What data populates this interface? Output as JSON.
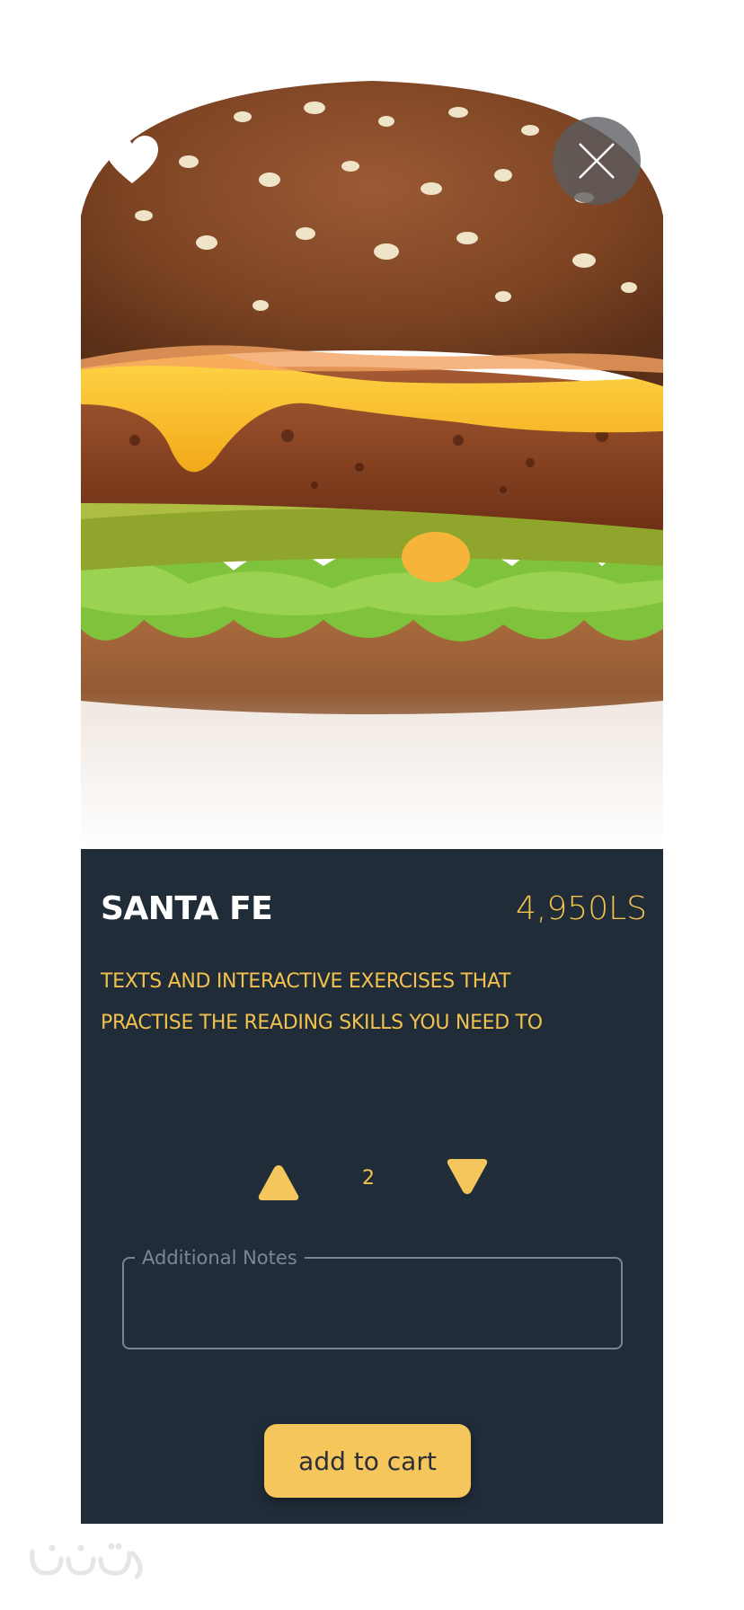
{
  "product": {
    "name": "SANTA FE",
    "price": "4,950LS",
    "description_lines": [
      "TEXTS AND INTERACTIVE EXERCISES THAT",
      "PRACTISE THE READING SKILLS YOU NEED TO"
    ],
    "image_icon": "burger-photo"
  },
  "actions": {
    "favorite_icon": "heart-icon",
    "close_icon": "close-icon",
    "increase_icon": "triangle-up-icon",
    "decrease_icon": "triangle-down-icon"
  },
  "quantity": {
    "value": "2"
  },
  "notes": {
    "label": "Additional Notes",
    "value": ""
  },
  "cart": {
    "add_label": "add to cart"
  },
  "colors": {
    "panel_bg": "#212c39",
    "accent": "#f2c14e",
    "button_bg": "#f5c65c",
    "title": "#ffffff"
  }
}
